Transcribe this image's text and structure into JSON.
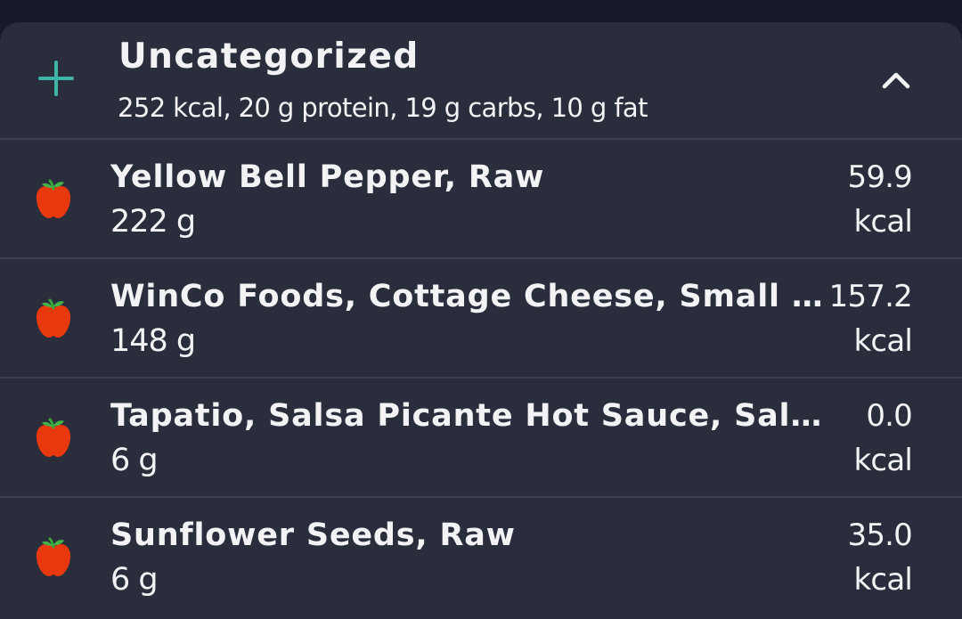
{
  "meal": {
    "title": "Uncategorized",
    "summary": "252 kcal, 20 g protein, 19 g carbs, 10 g fat",
    "add_icon": "plus-icon",
    "collapse_icon": "chevron-up-icon",
    "accent_color": "#3fb5a8"
  },
  "items": [
    {
      "name": "Yellow Bell Pepper, Raw",
      "amount": "222 g",
      "kcal": "59.9",
      "unit": "kcal",
      "icon": "apple-icon"
    },
    {
      "name": "WinCo Foods, Cottage Cheese, Small Curd",
      "amount": "148 g",
      "kcal": "157.2",
      "unit": "kcal",
      "icon": "apple-icon"
    },
    {
      "name": "Tapatio, Salsa Picante Hot Sauce, Salsa Picante",
      "amount": "6 g",
      "kcal": "0.0",
      "unit": "kcal",
      "icon": "apple-icon"
    },
    {
      "name": "Sunflower Seeds, Raw",
      "amount": "6 g",
      "kcal": "35.0",
      "unit": "kcal",
      "icon": "apple-icon"
    }
  ]
}
